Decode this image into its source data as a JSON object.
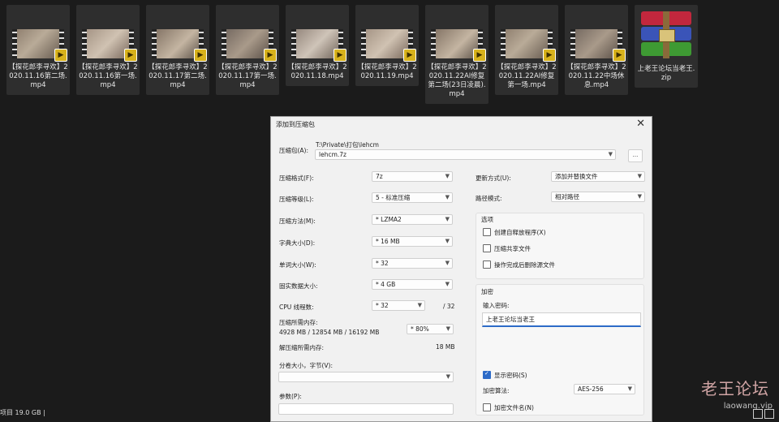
{
  "files": [
    {
      "name": "【探花郎李寻欢】2020.11.16第二场.mp4",
      "kind": "video"
    },
    {
      "name": "【探花郎李寻欢】2020.11.16第一场.mp4",
      "kind": "video"
    },
    {
      "name": "【探花郎李寻欢】2020.11.17第二场.mp4",
      "kind": "video"
    },
    {
      "name": "【探花郎李寻欢】2020.11.17第一场.mp4",
      "kind": "video"
    },
    {
      "name": "【探花郎李寻欢】2020.11.18.mp4",
      "kind": "video"
    },
    {
      "name": "【探花郎李寻欢】2020.11.19.mp4",
      "kind": "video"
    },
    {
      "name": "【探花郎李寻欢】2020.11.22AI修复第二场(23日凌晨).mp4",
      "kind": "video"
    },
    {
      "name": "【探花郎李寻欢】2020.11.22AI修复第一场.mp4",
      "kind": "video"
    },
    {
      "name": "【探花郎李寻欢】2020.11.22中场休息.mp4",
      "kind": "video"
    },
    {
      "name": "上老王论坛当老王.zip",
      "kind": "zip"
    }
  ],
  "status": {
    "text": "项目  19.0 GB  |"
  },
  "watermark": {
    "line1": "老王论坛",
    "line2": "laowang.vip"
  },
  "dialog": {
    "title": "添加到压缩包",
    "close": "✕",
    "archive_label": "压缩包(A):",
    "archive_path": "T:\\Private\\打包\\lehcm",
    "archive_name": "lehcm.7z",
    "browse": "...",
    "format_label": "压缩格式(F):",
    "format_value": "7z",
    "level_label": "压缩等级(L):",
    "level_value": "5 - 标准压缩",
    "method_label": "压缩方法(M):",
    "method_value": "* LZMA2",
    "dict_label": "字典大小(D):",
    "dict_value": "* 16 MB",
    "word_label": "单词大小(W):",
    "word_value": "* 32",
    "solid_label": "固实数据大小:",
    "solid_value": "* 4 GB",
    "cpu_label": "CPU 线程数:",
    "cpu_value": "* 32",
    "cpu_max": "/ 32",
    "mem_label": "压缩所需内存:",
    "mem_detail": "4928 MB / 12854 MB / 16192 MB",
    "mem_value": "* 80%",
    "decomp_label": "解压缩所需内存:",
    "decomp_value": "18 MB",
    "split_label": "分卷大小，字节(V):",
    "params_label": "参数(P):",
    "update_label": "更新方式(U):",
    "update_value": "添加并替换文件",
    "pathmode_label": "路径模式:",
    "pathmode_value": "相对路径",
    "options_title": "选项",
    "opt_sfx": "创建自释放程序(X)",
    "opt_shared": "压缩共享文件",
    "opt_delete": "操作完成后删除源文件",
    "encrypt_title": "加密",
    "pwd_label": "输入密码:",
    "pwd_value": "上老王论坛当老王",
    "show_pwd": "显示密码(S)",
    "enc_method_label": "加密算法:",
    "enc_method_value": "AES-256",
    "encrypt_names": "加密文件名(N)"
  }
}
